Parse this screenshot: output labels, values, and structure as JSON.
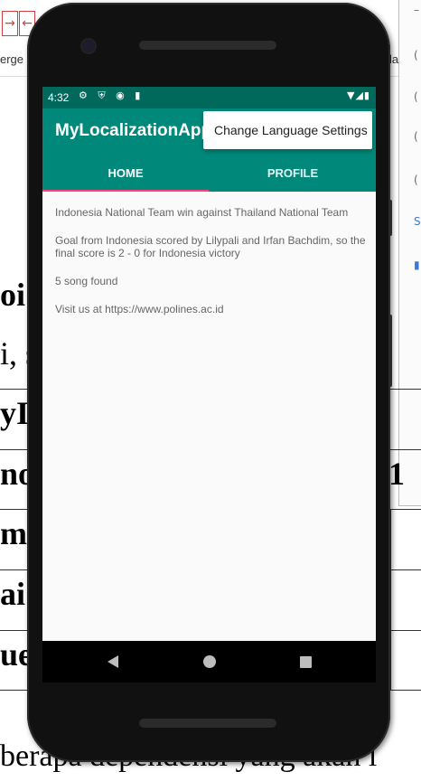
{
  "background_doc": {
    "toolbar_fragment_left": "erge",
    "toolbar_fragment_right": "la",
    "big_text_fragments": [
      "oi",
      "i, s",
      "yI",
      "no",
      "mp",
      "ai",
      "ue",
      "1"
    ],
    "bottom_sentence": "berapa dependensi yang akan l"
  },
  "status_bar": {
    "time": "4:32",
    "left_icons": "⚙ ⛨ ◉ ▮",
    "right_icons": "▼◢▮"
  },
  "app_bar": {
    "title": "MyLocalizationApp"
  },
  "overflow_menu": {
    "item": "Change Language Settings"
  },
  "tabs": [
    {
      "label": "HOME",
      "selected": true
    },
    {
      "label": "PROFILE",
      "selected": false
    }
  ],
  "content": {
    "lines": [
      "Indonesia National Team win against Thailand National Team",
      "Goal from Indonesia scored by Lilypali and Irfan Bachdim, so the final score is 2 - 0 for Indonesia victory",
      "5 song found",
      "Visit us at https://www.polines.ac.id"
    ]
  },
  "colors": {
    "primary": "#00897b",
    "primary_dark": "#00695c",
    "accent": "#ff4081"
  }
}
